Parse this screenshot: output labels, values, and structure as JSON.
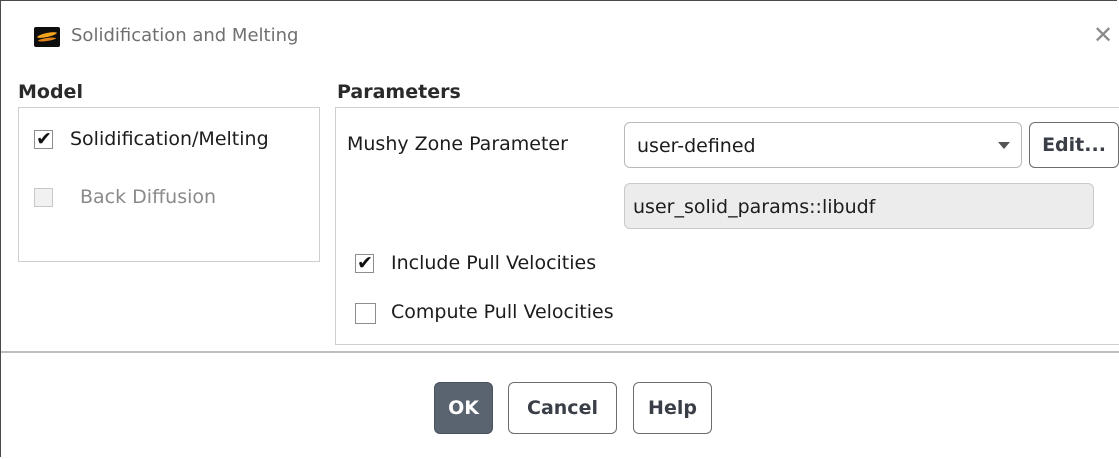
{
  "window": {
    "title": "Solidification and Melting",
    "icon": "fluent-app-icon",
    "close_icon": "close-icon"
  },
  "model": {
    "heading": "Model",
    "options": [
      {
        "label": "Solidification/Melting",
        "checked": true,
        "enabled": true
      },
      {
        "label": "Back Diffusion",
        "checked": false,
        "enabled": false
      }
    ]
  },
  "parameters": {
    "heading": "Parameters",
    "mushy_zone_label": "Mushy Zone Parameter",
    "mushy_zone_value": "user-defined",
    "edit_label": "Edit...",
    "udf_value": "user_solid_params::libudf",
    "options": [
      {
        "label": "Include Pull Velocities",
        "checked": true
      },
      {
        "label": "Compute Pull Velocities",
        "checked": false
      }
    ]
  },
  "buttons": {
    "ok": "OK",
    "cancel": "Cancel",
    "help": "Help"
  }
}
